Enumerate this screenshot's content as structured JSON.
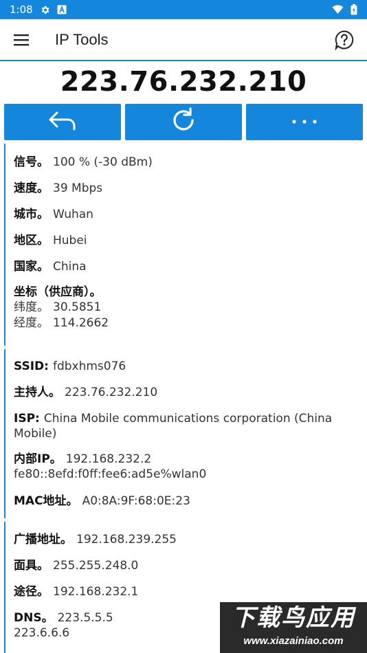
{
  "status_bar": {
    "time": "1:08"
  },
  "app_bar": {
    "title": "IP Tools"
  },
  "ip_address": "223.76.232.210",
  "colors": {
    "accent": "#1486dc"
  },
  "actions": [
    {
      "icon": "share-arrow-icon"
    },
    {
      "icon": "refresh-icon"
    },
    {
      "icon": "more-dots-icon",
      "label": "• • •"
    }
  ],
  "section1": {
    "signal": {
      "label": "信号。",
      "value": "100 % (-30 dBm)"
    },
    "speed": {
      "label": "速度。",
      "value": "39 Mbps"
    },
    "city": {
      "label": "城市。",
      "value": "Wuhan"
    },
    "region": {
      "label": "地区。",
      "value": "Hubei"
    },
    "country": {
      "label": "国家。",
      "value": "China"
    },
    "coords": {
      "label": "坐标（供应商）。",
      "lat_label": "纬度。",
      "lat_value": "30.5851",
      "lon_label": "经度。",
      "lon_value": "114.2662"
    }
  },
  "section2": {
    "ssid": {
      "label": "SSID:",
      "value": "fdbxhms076"
    },
    "host": {
      "label": "主持人。",
      "value": "223.76.232.210"
    },
    "isp": {
      "label": "ISP:",
      "value": "China Mobile communications corporation (China",
      "value2": "Mobile)"
    },
    "internal_ip": {
      "label": "内部IP。",
      "value": "192.168.232.2",
      "value2": "fe80::8efd:f0ff:fee6:ad5e%wlan0"
    },
    "mac": {
      "label": "MAC地址。",
      "value": "A0:8A:9F:68:0E:23"
    }
  },
  "section3": {
    "broadcast": {
      "label": "广播地址。",
      "value": "192.168.239.255"
    },
    "mask": {
      "label": "面具。",
      "value": "255.255.248.0"
    },
    "gateway": {
      "label": "途径。",
      "value": "192.168.232.1"
    },
    "dns": {
      "label": "DNS。",
      "value": "223.5.5.5",
      "value2": "223.6.6.6"
    }
  },
  "watermark": {
    "title": "下载鸟应用",
    "url": "www.xiazainiao.com"
  }
}
